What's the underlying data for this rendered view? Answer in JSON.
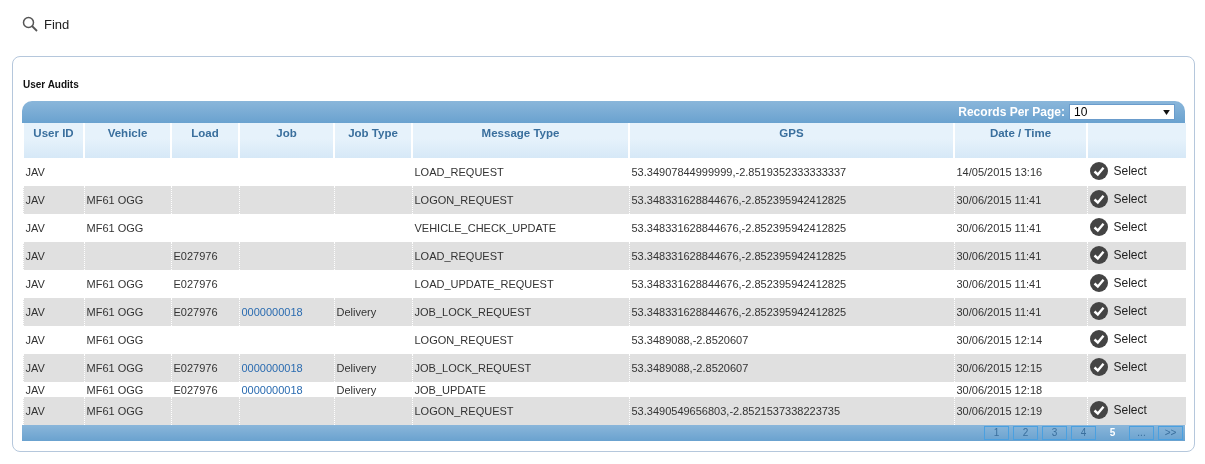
{
  "find": {
    "label": "Find"
  },
  "panel": {
    "title": "User Audits"
  },
  "records_per_page": {
    "label": "Records Per Page:",
    "value": "10"
  },
  "columns": [
    "User ID",
    "Vehicle",
    "Load",
    "Job",
    "Job Type",
    "Message Type",
    "GPS",
    "Date / Time"
  ],
  "rows": [
    {
      "cells": [
        "JAV",
        "",
        "",
        "",
        "",
        "LOAD_REQUEST",
        "53.34907844999999,-2.8519352333333337",
        "14/05/2015 13:16"
      ],
      "action": "Select"
    },
    {
      "cells": [
        "JAV",
        "MF61 OGG",
        "",
        "",
        "",
        "LOGON_REQUEST",
        "53.348331628844676,-2.852395942412825",
        "30/06/2015 11:41"
      ],
      "action": "Select"
    },
    {
      "cells": [
        "JAV",
        "MF61 OGG",
        "",
        "",
        "",
        "VEHICLE_CHECK_UPDATE",
        "53.348331628844676,-2.852395942412825",
        "30/06/2015 11:41"
      ],
      "action": "Select"
    },
    {
      "cells": [
        "JAV",
        "",
        "E027976",
        "",
        "",
        "LOAD_REQUEST",
        "53.348331628844676,-2.852395942412825",
        "30/06/2015 11:41"
      ],
      "action": "Select"
    },
    {
      "cells": [
        "JAV",
        "MF61 OGG",
        "E027976",
        "",
        "",
        "LOAD_UPDATE_REQUEST",
        "53.348331628844676,-2.852395942412825",
        "30/06/2015 11:41"
      ],
      "action": "Select"
    },
    {
      "cells": [
        "JAV",
        "MF61 OGG",
        "E027976",
        "0000000018",
        "Delivery",
        "JOB_LOCK_REQUEST",
        "53.348331628844676,-2.852395942412825",
        "30/06/2015 11:41"
      ],
      "action": "Select"
    },
    {
      "cells": [
        "JAV",
        "MF61 OGG",
        "",
        "",
        "",
        "LOGON_REQUEST",
        "53.3489088,-2.8520607",
        "30/06/2015 12:14"
      ],
      "action": "Select"
    },
    {
      "cells": [
        "JAV",
        "MF61 OGG",
        "E027976",
        "0000000018",
        "Delivery",
        "JOB_LOCK_REQUEST",
        "53.3489088,-2.8520607",
        "30/06/2015 12:15"
      ],
      "action": "Select"
    },
    {
      "cells": [
        "JAV",
        "MF61 OGG",
        "E027976",
        "0000000018",
        "Delivery",
        "JOB_UPDATE",
        "",
        "30/06/2015 12:18"
      ]
    },
    {
      "cells": [
        "JAV",
        "MF61 OGG",
        "",
        "",
        "",
        "LOGON_REQUEST",
        "53.3490549656803,-2.8521537338223735",
        "30/06/2015 12:19"
      ],
      "action": "Select"
    }
  ],
  "pages": [
    {
      "label": "1",
      "selected": false
    },
    {
      "label": "2",
      "selected": false
    },
    {
      "label": "3",
      "selected": false
    },
    {
      "label": "4",
      "selected": false
    },
    {
      "label": "5",
      "selected": true
    },
    {
      "label": "...",
      "selected": false
    },
    {
      "label": ">>",
      "selected": false
    }
  ]
}
